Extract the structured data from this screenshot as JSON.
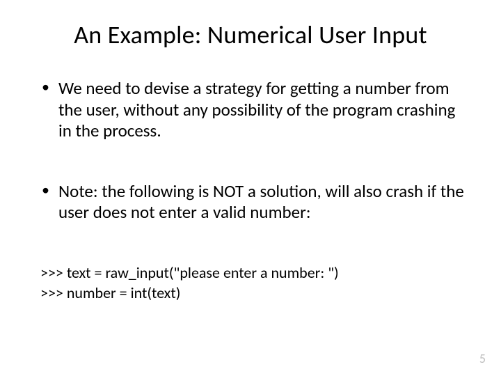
{
  "title": "An Example: Numerical User Input",
  "bullets": [
    "We need to devise a strategy for getting a number from the user, without any possibility of the program crashing in the process.",
    "Note: the following is NOT a solution, will also crash if the user does not enter a valid number:"
  ],
  "code": {
    "line1": ">>> text = raw_input(\"please enter a number: \")",
    "line2": ">>> number = int(text)"
  },
  "page_number": "5"
}
